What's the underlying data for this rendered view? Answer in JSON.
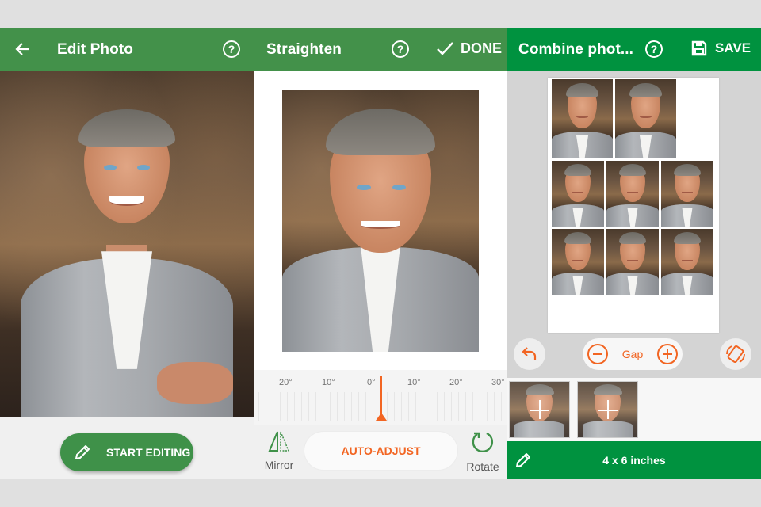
{
  "colors": {
    "app_bar_green": "#43914a",
    "app_bar_green_dark": "#00923f",
    "accent_orange": "#f26522",
    "background": "#e0e0e0"
  },
  "panels": [
    {
      "id": "edit-photo",
      "app_bar": {
        "back_icon": "arrow-left-icon",
        "title": "Edit Photo",
        "help_icon": "help-circle-icon",
        "help_glyph": "?"
      },
      "start_editing": {
        "icon": "pencil-icon",
        "label": "START EDITING"
      }
    },
    {
      "id": "straighten",
      "app_bar": {
        "title": "Straighten",
        "help_icon": "help-circle-icon",
        "help_glyph": "?",
        "done_icon": "checkmark-icon",
        "done_label": "DONE"
      },
      "ruler": {
        "ticks": [
          "20°",
          "10°",
          "0°",
          "10°",
          "20°",
          "30°"
        ],
        "current_angle_deg": 0
      },
      "mirror": {
        "icon": "mirror-icon",
        "label": "Mirror"
      },
      "auto_adjust": {
        "label": "AUTO-ADJUST"
      },
      "rotate": {
        "icon": "rotate-icon",
        "label": "Rotate"
      }
    },
    {
      "id": "combine-photos",
      "app_bar": {
        "title": "Combine phot...",
        "help_icon": "help-circle-icon",
        "help_glyph": "?",
        "save_icon": "floppy-disk-icon",
        "save_label": "SAVE"
      },
      "sheet": {
        "rows": [
          2,
          3,
          3
        ],
        "photo_count": 8
      },
      "controls": {
        "undo_icon": "undo-icon",
        "gap_label": "Gap",
        "minus_icon": "minus-circle-icon",
        "plus_icon": "plus-circle-icon",
        "orientation_icon": "rotate-orientation-icon"
      },
      "tray": {
        "items": [
          {
            "icon": "add-photo-icon"
          },
          {
            "icon": "add-photo-icon"
          }
        ]
      },
      "footer": {
        "edit_icon": "pencil-icon",
        "size_label": "4 x 6 inches"
      }
    }
  ]
}
